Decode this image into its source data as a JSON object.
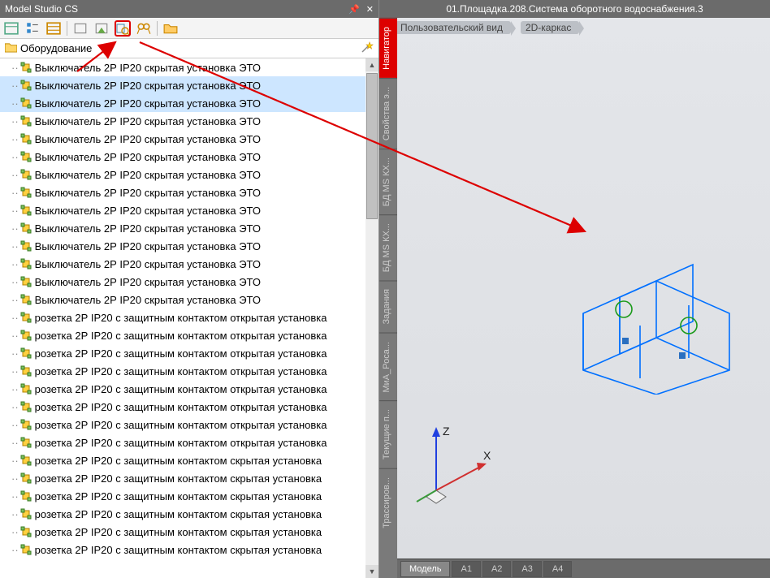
{
  "panel": {
    "title": "Model Studio CS"
  },
  "breadcrumb": {
    "label": "Оборудование"
  },
  "doc": {
    "title": "01.Площадка.208.Система оборотного водоснабжения.3"
  },
  "tags": {
    "view": "Пользовательский вид",
    "mode": "2D-каркас"
  },
  "side_tabs": [
    "Навигатор",
    "Свойства э...",
    "БД MS КХ...",
    "БД MS КХ...",
    "Задания",
    "МиА_Роса...",
    "Текущие п...",
    "Трассиров..."
  ],
  "bottom_tabs": {
    "active": "Модель",
    "others": [
      "А1",
      "А2",
      "А3",
      "А4"
    ]
  },
  "axes": {
    "z": "Z",
    "x": "X"
  },
  "tree": {
    "items": [
      {
        "label": "Выключатель 2Р IP20 скрытая установка  ЭТО",
        "sel": false
      },
      {
        "label": "Выключатель 2Р IP20 скрытая установка  ЭТО",
        "sel": true
      },
      {
        "label": "Выключатель 2Р IP20 скрытая установка  ЭТО",
        "sel": true
      },
      {
        "label": "Выключатель 2Р IP20 скрытая установка  ЭТО",
        "sel": false
      },
      {
        "label": "Выключатель 2Р IP20 скрытая установка  ЭТО",
        "sel": false
      },
      {
        "label": "Выключатель 2Р IP20 скрытая установка  ЭТО",
        "sel": false
      },
      {
        "label": "Выключатель 2Р IP20 скрытая установка  ЭТО",
        "sel": false
      },
      {
        "label": "Выключатель 2Р IP20 скрытая установка  ЭТО",
        "sel": false
      },
      {
        "label": "Выключатель 2Р IP20 скрытая установка  ЭТО",
        "sel": false
      },
      {
        "label": "Выключатель 2Р IP20 скрытая установка  ЭТО",
        "sel": false
      },
      {
        "label": "Выключатель 2Р IP20 скрытая установка  ЭТО",
        "sel": false
      },
      {
        "label": "Выключатель 2Р IP20 скрытая установка  ЭТО",
        "sel": false
      },
      {
        "label": "Выключатель 2Р IP20 скрытая установка  ЭТО",
        "sel": false
      },
      {
        "label": "Выключатель 2Р IP20 скрытая установка  ЭТО",
        "sel": false
      },
      {
        "label": "розетка 2Р IP20 с защитным контактом  открытая установка",
        "sel": false
      },
      {
        "label": "розетка 2Р IP20 с защитным контактом  открытая установка",
        "sel": false
      },
      {
        "label": "розетка 2Р IP20 с защитным контактом  открытая установка",
        "sel": false
      },
      {
        "label": "розетка 2Р IP20 с защитным контактом  открытая установка",
        "sel": false
      },
      {
        "label": "розетка 2Р IP20 с защитным контактом  открытая установка",
        "sel": false
      },
      {
        "label": "розетка 2Р IP20 с защитным контактом  открытая установка",
        "sel": false
      },
      {
        "label": "розетка 2Р IP20 с защитным контактом  открытая установка",
        "sel": false
      },
      {
        "label": "розетка 2Р IP20 с защитным контактом  открытая установка",
        "sel": false
      },
      {
        "label": "розетка 2Р IP20 с защитным контактом скрытая установка",
        "sel": false
      },
      {
        "label": "розетка 2Р IP20 с защитным контактом скрытая установка",
        "sel": false
      },
      {
        "label": "розетка 2Р IP20 с защитным контактом скрытая установка",
        "sel": false
      },
      {
        "label": "розетка 2Р IP20 с защитным контактом скрытая установка",
        "sel": false
      },
      {
        "label": "розетка 2Р IP20 с защитным контактом скрытая установка",
        "sel": false
      },
      {
        "label": "розетка 2Р IP20 с защитным контактом скрытая установка",
        "sel": false
      }
    ]
  }
}
